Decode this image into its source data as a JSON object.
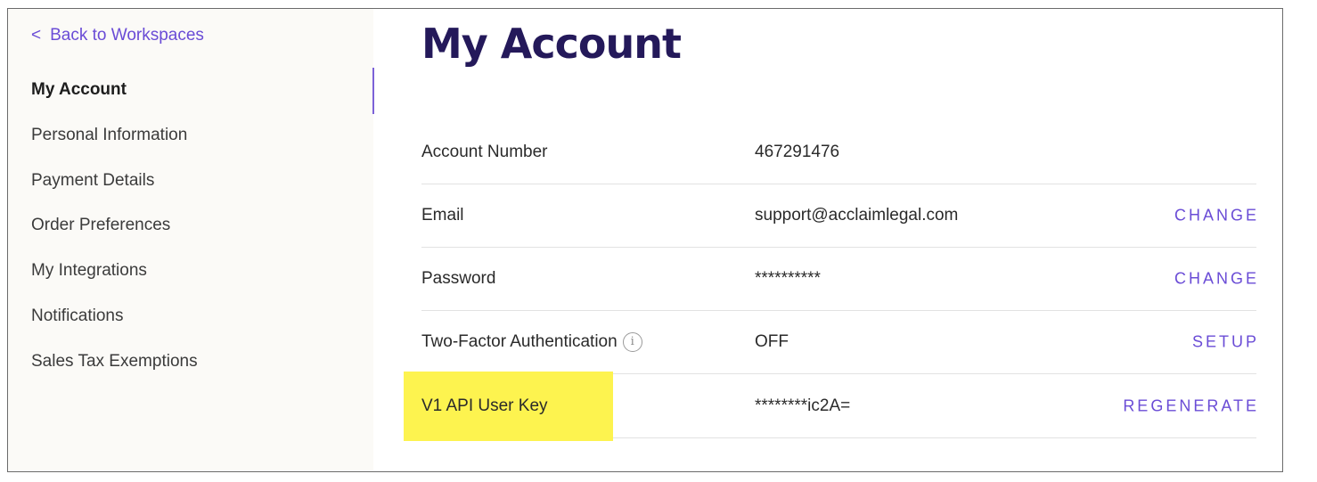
{
  "sidebar": {
    "back_label": "Back to Workspaces",
    "back_chevron": "<",
    "items": [
      {
        "label": "My Account",
        "active": true
      },
      {
        "label": "Personal Information"
      },
      {
        "label": "Payment Details"
      },
      {
        "label": "Order Preferences"
      },
      {
        "label": "My Integrations"
      },
      {
        "label": "Notifications"
      },
      {
        "label": "Sales Tax Exemptions"
      }
    ]
  },
  "main": {
    "title": "My Account",
    "rows": [
      {
        "label": "Account Number",
        "value": "467291476",
        "action": ""
      },
      {
        "label": "Email",
        "value": "support@acclaimlegal.com",
        "action": "CHANGE"
      },
      {
        "label": "Password",
        "value": "**********",
        "action": "CHANGE"
      },
      {
        "label": "Two-Factor Authentication",
        "value": "OFF",
        "action": "SETUP",
        "info_icon": "info-icon"
      },
      {
        "label": "V1 API User Key",
        "value": "********ic2A=",
        "action": "REGENERATE",
        "highlighted": true
      }
    ]
  },
  "colors": {
    "accent": "#6a4cd6",
    "title": "#24195a",
    "highlight": "#fdf34f",
    "sidebar_bg": "#fbfaf7"
  }
}
